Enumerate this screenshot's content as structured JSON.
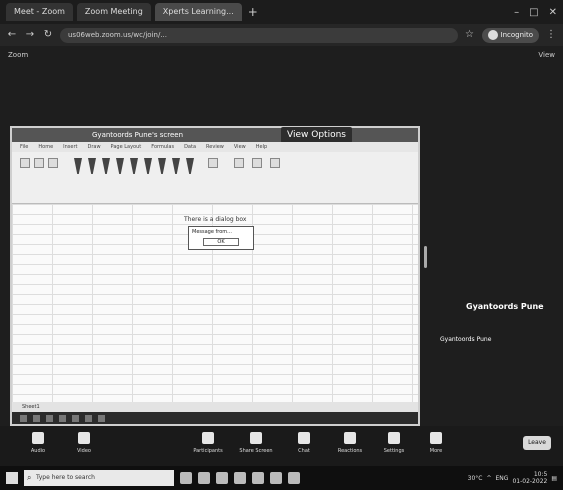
{
  "browser": {
    "tabs": [
      {
        "label": "Meet - Zoom"
      },
      {
        "label": "Zoom Meeting"
      },
      {
        "label": "Xperts Learning..."
      }
    ],
    "url": "us06web.zoom.us/wc/join/...",
    "profile_label": "Incognito"
  },
  "meeting": {
    "top_left": "Zoom",
    "top_right": "View",
    "shared_window_title": "Gyantoords Pune's screen",
    "view_options_label": "View Options",
    "ribbon_tabs": [
      "File",
      "Home",
      "Insert",
      "Draw",
      "Page Layout",
      "Formulas",
      "Data",
      "Review",
      "View",
      "Help"
    ],
    "cell_note": "There is a dialog box",
    "popup_text": "Message from...",
    "popup_button": "OK",
    "sheet_tab": "Sheet1",
    "participant_name": "Gyantoords Pune",
    "participant_sub": "Gyantoords Pune"
  },
  "controls": {
    "audio": "Audio",
    "video": "Video",
    "participants": "Participants",
    "share": "Share Screen",
    "chat": "Chat",
    "reactions": "Reactions",
    "settings": "Settings",
    "more": "More",
    "end": "Leave"
  },
  "taskbar": {
    "search_placeholder": "Type here to search",
    "weather": "30°C",
    "lang": "ENG",
    "time": "10:5",
    "date": "01-02-2022"
  }
}
